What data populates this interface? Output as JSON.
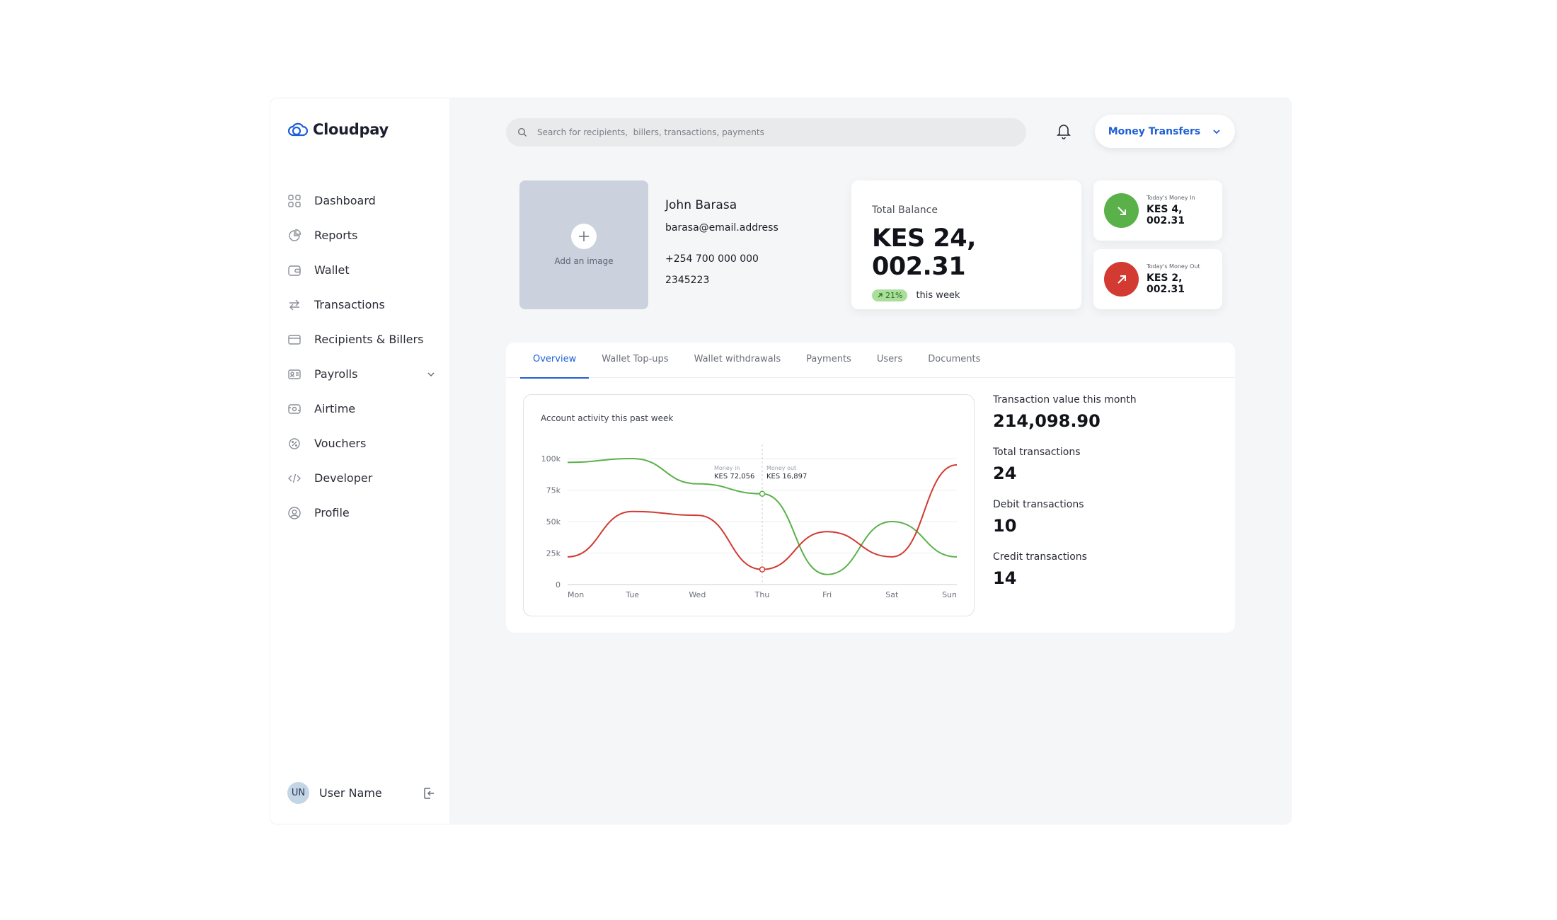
{
  "brand": {
    "name": "Cloudpay",
    "accent": "#1f5fd6"
  },
  "sidebar": {
    "items": [
      {
        "label": "Dashboard",
        "icon": "grid-icon"
      },
      {
        "label": "Reports",
        "icon": "pie-chart-icon"
      },
      {
        "label": "Wallet",
        "icon": "wallet-icon"
      },
      {
        "label": "Transactions",
        "icon": "arrows-swap-icon"
      },
      {
        "label": "Recipients & Billers",
        "icon": "card-icon"
      },
      {
        "label": "Payrolls",
        "icon": "id-card-icon"
      },
      {
        "label": "Airtime",
        "icon": "airtime-icon"
      },
      {
        "label": "Vouchers",
        "icon": "voucher-icon"
      },
      {
        "label": "Developer",
        "icon": "code-icon"
      },
      {
        "label": "Profile",
        "icon": "user-circle-icon"
      }
    ],
    "user": {
      "initials": "UN",
      "name": "User Name"
    }
  },
  "header": {
    "search_placeholder": "Search for recipients,  billers, transactions, payments",
    "dropdown_label": "Money Transfers"
  },
  "profile": {
    "add_image": "Add an image",
    "name": "John Barasa",
    "email": "barasa@email.address",
    "phone": "+254 700 000 000",
    "id": "2345223"
  },
  "balance": {
    "label": "Total Balance",
    "value": "KES 24, 002.31",
    "change": "21%",
    "period": "this week"
  },
  "money_in": {
    "label": "Today's Money In",
    "value": "KES 4, 002.31",
    "color": "#5ab14a"
  },
  "money_out": {
    "label": "Today's Money Out",
    "value": "KES 2, 002.31",
    "color": "#d23a32"
  },
  "tabs": [
    "Overview",
    "Wallet Top-ups",
    "Wallet withdrawals",
    "Payments",
    "Users",
    "Documents"
  ],
  "stats": [
    {
      "label": "Transaction value this month",
      "value": "214,098.90"
    },
    {
      "label": "Total transactions",
      "value": "24"
    },
    {
      "label": "Debit transactions",
      "value": "10"
    },
    {
      "label": "Credit transactions",
      "value": "14"
    }
  ],
  "chart_data": {
    "type": "line",
    "title": "Account activity this past week",
    "categories": [
      "Mon",
      "Tue",
      "Wed",
      "Thu",
      "Fri",
      "Sat",
      "Sun"
    ],
    "ylim": [
      0,
      100000
    ],
    "yticks": [
      "0",
      "25k",
      "50k",
      "75k",
      "100k"
    ],
    "series": [
      {
        "name": "Money in",
        "color": "#5ab14a",
        "values": [
          97000,
          100000,
          80000,
          72056,
          8000,
          50000,
          22000
        ]
      },
      {
        "name": "Money out",
        "color": "#d23a32",
        "values": [
          22000,
          58000,
          55000,
          12000,
          42000,
          22000,
          95000
        ]
      }
    ],
    "tooltip": {
      "category": "Thu",
      "money_in_label": "Money in",
      "money_in_value": "KES 72,056",
      "money_out_label": "Money out",
      "money_out_value": "KES 16,897"
    }
  }
}
